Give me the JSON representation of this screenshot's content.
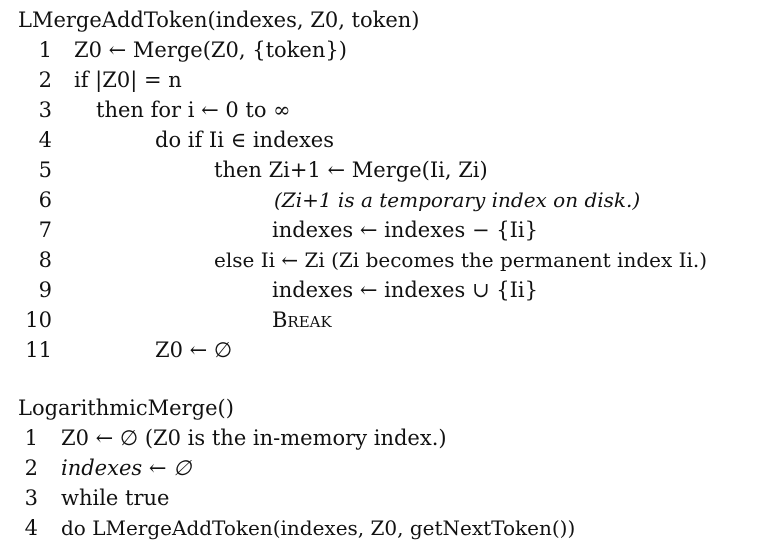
{
  "algorithm1": {
    "header": "LMergeAddToken(indexes, Z0, token)",
    "lines": [
      {
        "num": "1",
        "text": "Z0 ← Merge(Z0, {token})"
      },
      {
        "num": "2",
        "text": "if |Z0| = n"
      },
      {
        "num": "3",
        "text": "then for i ← 0 to ∞"
      },
      {
        "num": "4",
        "text": "do if Ii ∈ indexes"
      },
      {
        "num": "5",
        "text": "then Zi+1 ← Merge(Ii, Zi)"
      },
      {
        "num": "6",
        "text": "(Zi+1 is a temporary index on disk.)"
      },
      {
        "num": "7",
        "text": "indexes ← indexes − {Ii}"
      },
      {
        "num": "8",
        "text": "else Ii ← Zi (Zi becomes the permanent index Ii.)"
      },
      {
        "num": "9",
        "text": "indexes ← indexes ∪ {Ii}"
      },
      {
        "num": "10",
        "text": "Break"
      },
      {
        "num": "11",
        "text": "Z0 ← ∅"
      }
    ]
  },
  "algorithm2": {
    "header": "LogarithmicMerge()",
    "lines": [
      {
        "num": "1",
        "text": "Z0 ← ∅ (Z0 is the in-memory index.)"
      },
      {
        "num": "2",
        "text": "indexes ← ∅"
      },
      {
        "num": "3",
        "text": "while true"
      },
      {
        "num": "4",
        "text": "do LMergeAddToken(indexes, Z0, getNextToken())"
      }
    ]
  }
}
